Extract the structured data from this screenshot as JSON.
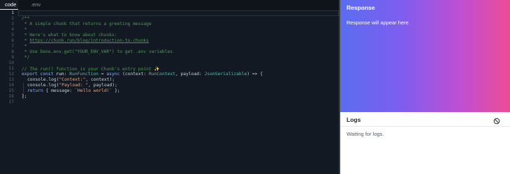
{
  "tabs": [
    {
      "label": "code",
      "active": true
    },
    {
      "label": ".env",
      "active": false
    }
  ],
  "editor": {
    "line_numbers": [
      "1",
      "2",
      "3",
      "4",
      "5",
      "6",
      "7",
      "8",
      "9",
      "10",
      "11",
      "12",
      "13",
      "14",
      "15",
      "16",
      "17"
    ],
    "current_line": "1"
  },
  "code": {
    "l2": "/**",
    "l3": " * A simple chunk that returns a greeting message",
    "l4": " *",
    "l5": " * Here's what to know about chunks:",
    "l6_prefix": " * ",
    "l6_link": "https://chunk.run/blog/introduction-to-chunks",
    "l7": " *",
    "l8": " * Use Deno.env.get(\"YOUR_ENV_VAR\") to get .env variables",
    "l9": " */",
    "l11": "// The run() function is your Chunk's entry point ✨",
    "l12": {
      "kw1": "export const ",
      "name": "run",
      "p1": ": ",
      "type1": "RunFunction",
      "p2": " = ",
      "kw2": "async",
      "p3": " (context: ",
      "type2": "RunContext",
      "p4": ", payload: ",
      "type3": "JsonSerializable",
      "p5": ") => {"
    },
    "l13": {
      "a": "console.log(",
      "s": "\"Context:\"",
      "b": ", context);"
    },
    "l14": {
      "a": "console.log(",
      "s": "\"Payload: \"",
      "b": ", payload);"
    },
    "l15": {
      "kw": "return",
      "a": " { message: ",
      "s": "`Hello world!`",
      "b": " };"
    },
    "l16": "};"
  },
  "response": {
    "title": "Response",
    "placeholder": "Response will appear here"
  },
  "logs": {
    "title": "Logs",
    "status": "Waiting for logs.",
    "clear_icon": "clear-circle-icon"
  },
  "colors": {
    "gradient": [
      "#5b6df0",
      "#7d5ef0",
      "#c14fd0",
      "#ee4c94"
    ],
    "editor_bg": "#131923",
    "comment": "#4f9a53",
    "keyword": "#7fb1ff",
    "type": "#49c0b8",
    "string": "#f0a574"
  }
}
